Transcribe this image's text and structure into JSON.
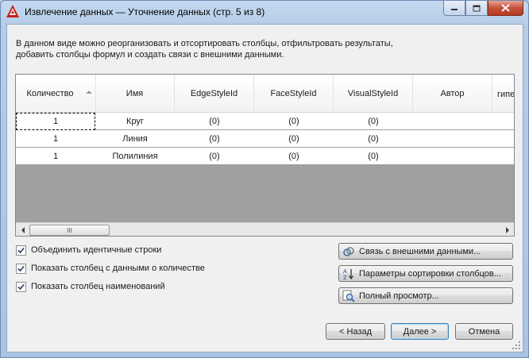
{
  "window": {
    "title": "Извлечение данных — Уточнение данных (стр. 5 из 8)",
    "app_icon": "autocad-icon",
    "controls": [
      "minimize-icon",
      "maximize-icon",
      "close-icon"
    ]
  },
  "intro_lines": [
    "В данном виде можно реорганизовать и отсортировать столбцы, отфильтровать результаты,",
    "добавить столбцы формул и создать связи с внешними данными."
  ],
  "grid": {
    "columns": [
      "Количество",
      "Имя",
      "EdgeStyleId",
      "FaceStyleId",
      "VisualStyleId",
      "Автор",
      "гипе"
    ],
    "sorted_column": "Количество",
    "rows": [
      [
        "1",
        "Круг",
        "(0)",
        "(0)",
        "(0)",
        "",
        ""
      ],
      [
        "1",
        "Линия",
        "(0)",
        "(0)",
        "(0)",
        "",
        ""
      ],
      [
        "1",
        "Полилиния",
        "(0)",
        "(0)",
        "(0)",
        "",
        ""
      ]
    ],
    "selected_cell": [
      0,
      0
    ],
    "scrollbar_grip": "III"
  },
  "options": [
    {
      "label": "Объединить идентичные строки",
      "checked": true
    },
    {
      "label": "Показать столбец с данными о количестве",
      "checked": true
    },
    {
      "label": "Показать столбец наименований",
      "checked": true
    }
  ],
  "side_buttons": [
    {
      "label": "Связь с внешними данными...",
      "icon": "link-external-data-icon"
    },
    {
      "label": "Параметры сортировки столбцов...",
      "icon": "sort-az-icon"
    },
    {
      "label": "Полный просмотр...",
      "icon": "full-preview-icon"
    }
  ],
  "nav": {
    "back": "< Назад",
    "next": "Далее >",
    "cancel": "Отмена"
  }
}
